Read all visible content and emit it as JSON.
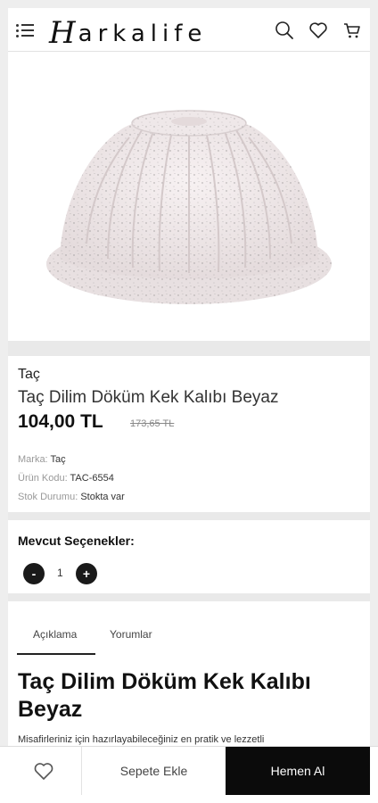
{
  "header": {
    "logo_initial": "H",
    "logo_rest": "arkalife",
    "icons": [
      "menu-icon",
      "search-icon",
      "heart-icon",
      "cart-icon"
    ]
  },
  "product": {
    "brand": "Taç",
    "title": "Taç Dilim Döküm Kek Kalıbı Beyaz",
    "price": "104,00 TL",
    "old_price": "173,65 TL",
    "meta": {
      "brand_label": "Marka:",
      "brand_value": "Taç",
      "code_label": "Ürün Kodu:",
      "code_value": "TAC-6554",
      "stock_label": "Stok Durumu:",
      "stock_value": "Stokta var"
    }
  },
  "options": {
    "label": "Mevcut Seçenekler:",
    "minus": "-",
    "quantity": "1",
    "plus": "+"
  },
  "tabs": {
    "description": "Açıklama",
    "reviews": "Yorumlar"
  },
  "description": {
    "title": "Taç Dilim Döküm Kek Kalıbı Beyaz",
    "text": "Misafirleriniz için hazırlayabileceğiniz en pratik ve lezzetli"
  },
  "bottom_bar": {
    "add_to_cart": "Sepete Ekle",
    "buy_now": "Hemen Al"
  },
  "colors": {
    "accent": "#0b0b0b",
    "background": "#eeeeee",
    "card": "#ffffff"
  }
}
